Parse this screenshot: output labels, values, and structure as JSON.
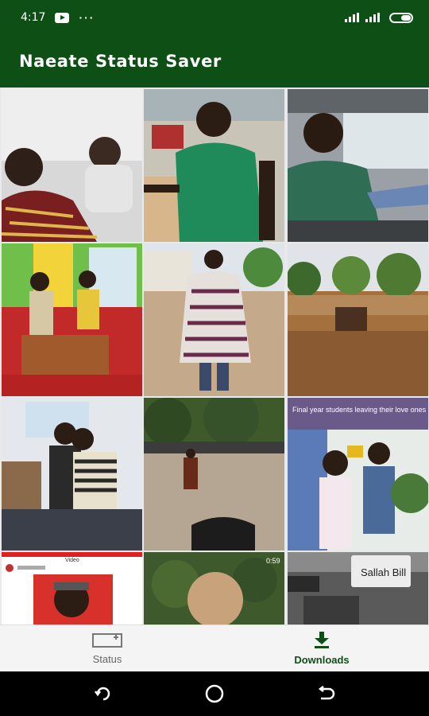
{
  "status_bar": {
    "time": "4:17",
    "dots": "···"
  },
  "app": {
    "title": "Naeate Status Saver"
  },
  "grid": {
    "overlay_caption": "Final year students leaving their love ones behind",
    "sign_text": "Sallah Bill",
    "video_duration": "0:59",
    "video_header": "Video"
  },
  "bottom_nav": {
    "items": [
      {
        "label": "Status",
        "icon": "status-photo-icon"
      },
      {
        "label": "Downloads",
        "icon": "download-icon"
      }
    ],
    "active_color": "#0d4f14"
  },
  "colors": {
    "primary": "#0d4f14",
    "nav_bg": "#f4f4f4"
  }
}
